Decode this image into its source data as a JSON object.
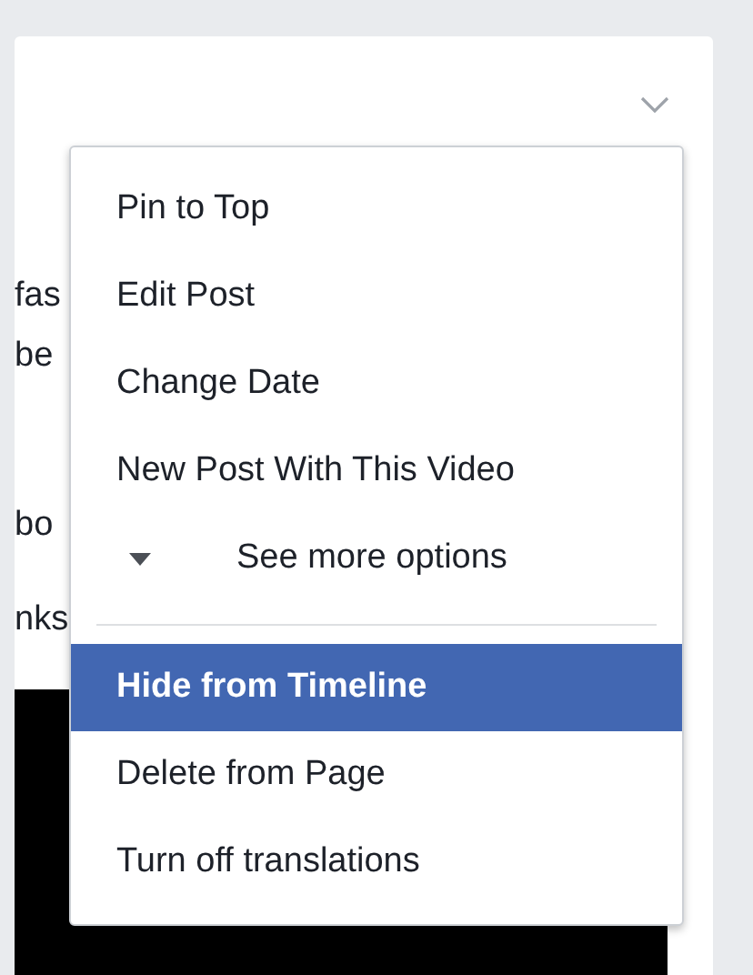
{
  "post": {
    "paragraphs": [
      [
        "fas",
        "be"
      ],
      [
        "bo",
        "nks"
      ]
    ]
  },
  "menu": {
    "items": [
      {
        "kind": "item",
        "label": "Pin to Top",
        "selected": false
      },
      {
        "kind": "item",
        "label": "Edit Post",
        "selected": false
      },
      {
        "kind": "item",
        "label": "Change Date",
        "selected": false
      },
      {
        "kind": "item",
        "label": "New Post With This Video",
        "selected": false
      },
      {
        "kind": "more",
        "label": "See more options",
        "selected": false
      },
      {
        "kind": "divider"
      },
      {
        "kind": "item",
        "label": "Hide from Timeline",
        "selected": true
      },
      {
        "kind": "item",
        "label": "Delete from Page",
        "selected": false
      },
      {
        "kind": "item",
        "label": "Turn off translations",
        "selected": false
      }
    ]
  }
}
